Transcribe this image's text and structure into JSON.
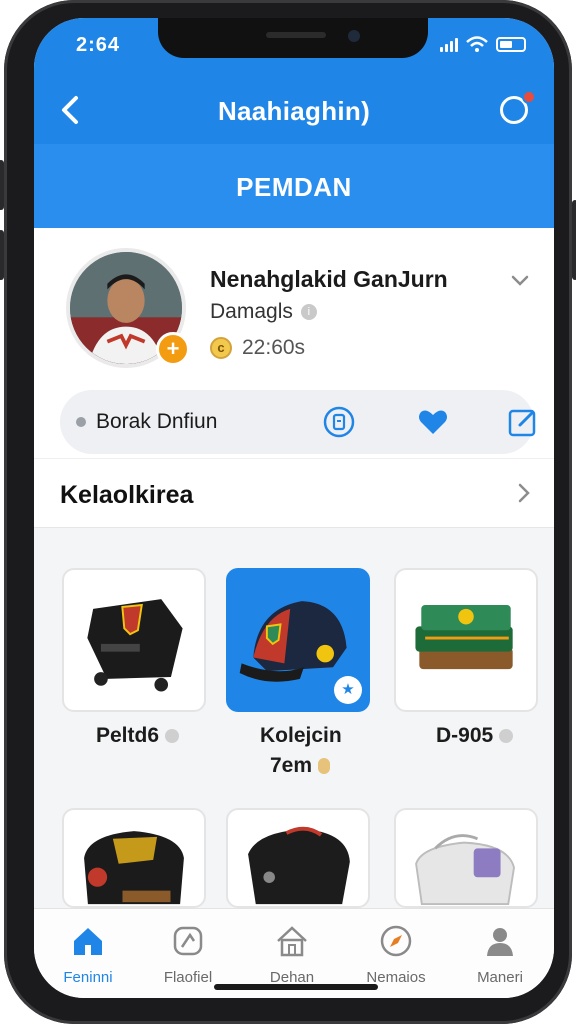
{
  "status_bar": {
    "time": "2:64"
  },
  "header": {
    "title": "Naahiaghin)",
    "back_icon": "chevron-left-icon",
    "notification_icon": "notification-bell-icon",
    "banner": "PEMDAN"
  },
  "profile": {
    "name": "Nenahglakid GanJurn",
    "subtitle": "Damagls",
    "points": "22:60s",
    "avatar_badge": "+"
  },
  "actions": {
    "label": "Borak Dnfiun",
    "icons": [
      "badge-icon",
      "heart-icon",
      "edit-icon"
    ]
  },
  "collection": {
    "title": "Kelaolkirea",
    "items": [
      {
        "name": "Peltd6",
        "icon": "backpack-icon",
        "selected": false
      },
      {
        "name": "Kolejcin",
        "sub": "7em",
        "icon": "cap-icon",
        "selected": true
      },
      {
        "name": "D-905",
        "icon": "stacked-bags-icon",
        "selected": false
      },
      {
        "name": "",
        "icon": "duffel-bag-icon",
        "selected": false
      },
      {
        "name": "",
        "icon": "black-bag-icon",
        "selected": false
      },
      {
        "name": "",
        "icon": "white-bag-icon",
        "selected": false
      }
    ]
  },
  "bottom_nav": [
    {
      "label": "Feninni",
      "icon": "home-icon",
      "active": true
    },
    {
      "label": "Flaofiel",
      "icon": "badge-icon",
      "active": false
    },
    {
      "label": "Dehan",
      "icon": "house-icon",
      "active": false
    },
    {
      "label": "Nemaios",
      "icon": "compass-icon",
      "active": false
    },
    {
      "label": "Maneri",
      "icon": "person-icon",
      "active": false
    }
  ],
  "colors": {
    "primary": "#1f86e8",
    "accent": "#f39c12",
    "alert": "#e74c3c"
  }
}
